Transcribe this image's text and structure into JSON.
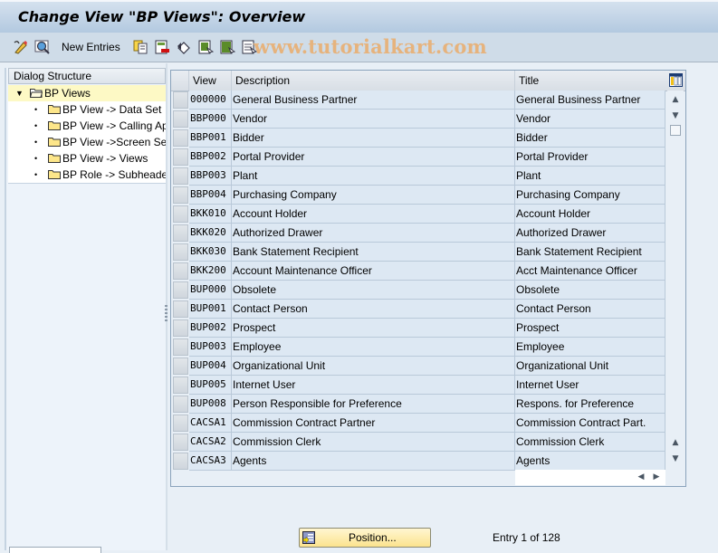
{
  "window": {
    "title": "Change View \"BP Views\": Overview"
  },
  "toolbar": {
    "icons": [
      "display-change-icon",
      "details-icon",
      "copy-as-icon",
      "delete-icon",
      "undo-change-icon",
      "select-all-icon",
      "select-block-icon",
      "deselect-all-icon"
    ],
    "new_entries_label": "New Entries",
    "watermark": "www.tutorialkart.com"
  },
  "dialog_structure": {
    "header": "Dialog Structure",
    "root": {
      "label": "BP Views",
      "expanded": true
    },
    "children": [
      {
        "label": "BP View -> Data Set"
      },
      {
        "label": "BP View -> Calling Ap"
      },
      {
        "label": "BP View ->Screen Se"
      },
      {
        "label": "BP View -> Views"
      },
      {
        "label": "BP Role -> Subheade"
      }
    ]
  },
  "table": {
    "columns": {
      "view": "View",
      "description": "Description",
      "title": "Title"
    },
    "rows": [
      {
        "view": "000000",
        "description": "General Business Partner",
        "title": "General Business Partner"
      },
      {
        "view": "BBP000",
        "description": "Vendor",
        "title": "Vendor"
      },
      {
        "view": "BBP001",
        "description": "Bidder",
        "title": "Bidder"
      },
      {
        "view": "BBP002",
        "description": "Portal Provider",
        "title": "Portal Provider"
      },
      {
        "view": "BBP003",
        "description": "Plant",
        "title": "Plant"
      },
      {
        "view": "BBP004",
        "description": "Purchasing Company",
        "title": "Purchasing Company"
      },
      {
        "view": "BKK010",
        "description": "Account Holder",
        "title": "Account Holder"
      },
      {
        "view": "BKK020",
        "description": "Authorized Drawer",
        "title": "Authorized Drawer"
      },
      {
        "view": "BKK030",
        "description": "Bank Statement Recipient",
        "title": "Bank Statement Recipient"
      },
      {
        "view": "BKK200",
        "description": "Account Maintenance Officer",
        "title": "Acct Maintenance Officer"
      },
      {
        "view": "BUP000",
        "description": "Obsolete",
        "title": "Obsolete"
      },
      {
        "view": "BUP001",
        "description": "Contact Person",
        "title": "Contact Person"
      },
      {
        "view": "BUP002",
        "description": "Prospect",
        "title": "Prospect"
      },
      {
        "view": "BUP003",
        "description": "Employee",
        "title": "Employee"
      },
      {
        "view": "BUP004",
        "description": "Organizational Unit",
        "title": "Organizational Unit"
      },
      {
        "view": "BUP005",
        "description": "Internet User",
        "title": "Internet User"
      },
      {
        "view": "BUP008",
        "description": "Person Responsible for Preference",
        "title": "Respons. for Preference"
      },
      {
        "view": "CACSA1",
        "description": "Commission Contract Partner",
        "title": "Commission Contract Part."
      },
      {
        "view": "CACSA2",
        "description": "Commission Clerk",
        "title": "Commission Clerk"
      },
      {
        "view": "CACSA3",
        "description": "Agents",
        "title": "Agents"
      }
    ]
  },
  "footer": {
    "position_button": "Position...",
    "entry_info": "Entry 1 of 128"
  }
}
